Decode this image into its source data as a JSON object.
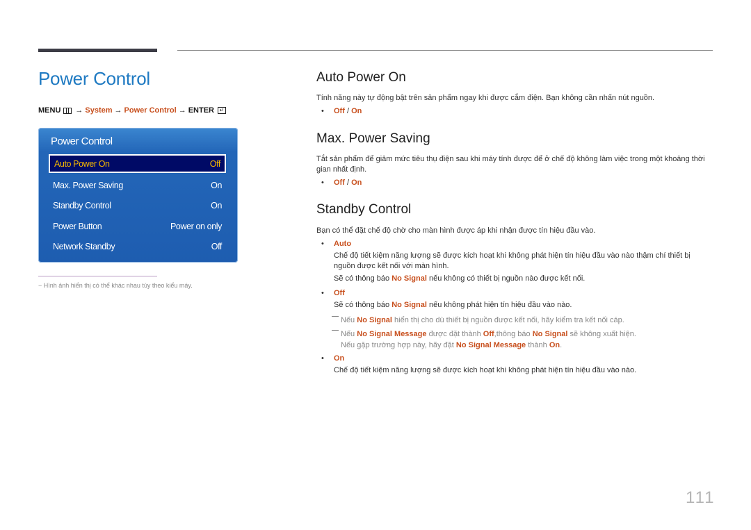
{
  "page_title": "Power Control",
  "breadcrumb": {
    "menu": "MENU",
    "menu_icon": "menu-icon",
    "arrow": "→",
    "system": "System",
    "power_control": "Power Control",
    "enter": "ENTER",
    "enter_icon": "enter-icon",
    "enter_glyph": "↵"
  },
  "osd": {
    "title": "Power Control",
    "items": [
      {
        "label": "Auto Power On",
        "value": "Off",
        "selected": true
      },
      {
        "label": "Max. Power Saving",
        "value": "On"
      },
      {
        "label": "Standby Control",
        "value": "On"
      },
      {
        "label": "Power Button",
        "value": "Power on only"
      },
      {
        "label": "Network Standby",
        "value": "Off"
      }
    ]
  },
  "footnote": "−  Hình ảnh hiển thị có thể khác nhau tùy theo kiểu máy.",
  "sections": {
    "auto_power_on": {
      "title": "Auto Power On",
      "desc": "Tính năng này tự động bật trên sản phẩm ngay khi được cắm điện. Bạn không cần nhấn nút nguồn.",
      "opt_a": "Off",
      "sep": " / ",
      "opt_b": "On"
    },
    "max_power_saving": {
      "title": "Max. Power Saving",
      "desc": "Tắt sản phẩm để giảm mức tiêu thụ điện sau khi máy tính được để ở chế độ không làm việc trong một khoảng thời gian nhất định.",
      "opt_a": "Off",
      "sep": " / ",
      "opt_b": "On"
    },
    "standby_control": {
      "title": "Standby Control",
      "desc": "Bạn có thể đặt chế độ chờ cho màn hình được áp khi nhận được tín hiệu đầu vào.",
      "auto": {
        "label": "Auto",
        "desc": "Chế độ tiết kiệm năng lượng sẽ được kích hoạt khi không phát hiện tín hiệu đầu vào nào thậm chí thiết bị nguồn được kết nối với màn hình.",
        "msg_pre": "Sẽ có thông báo ",
        "msg_key": "No Signal",
        "msg_post": " nếu không có thiết bị nguồn nào được kết nối."
      },
      "off": {
        "label": "Off",
        "msg_pre": "Sẽ có thông báo ",
        "msg_key": "No Signal",
        "msg_post": " nếu không phát hiện tín hiệu đầu vào nào.",
        "note1": {
          "pre": "Nếu ",
          "key": "No Signal",
          "post": " hiển thị cho dù thiết bị nguồn được kết nối, hãy kiểm tra kết nối cáp."
        },
        "note2": {
          "pre": "Nếu ",
          "key1": "No Signal Message",
          "mid1": " được đặt thành ",
          "key2": "Off",
          "mid2": ",thông báo ",
          "key3": "No Signal",
          "post": " sẽ không xuất hiện.",
          "line2_pre": "Nếu gặp trường hợp này, hãy đặt ",
          "line2_key1": "No Signal Message",
          "line2_mid": " thành ",
          "line2_key2": "On",
          "line2_post": "."
        }
      },
      "on": {
        "label": "On",
        "desc": "Chế độ tiết kiệm năng lượng sẽ được kích hoạt khi không phát hiện tín hiệu đầu vào nào."
      }
    }
  },
  "bullet": "•",
  "page_number": "111",
  "colors": {
    "title_blue": "#1f7ac2",
    "accent_orange": "#c8501e",
    "osd_blue": "#1e5db0",
    "osd_selected_bg": "#000a66",
    "osd_selected_text": "#f5b800"
  }
}
